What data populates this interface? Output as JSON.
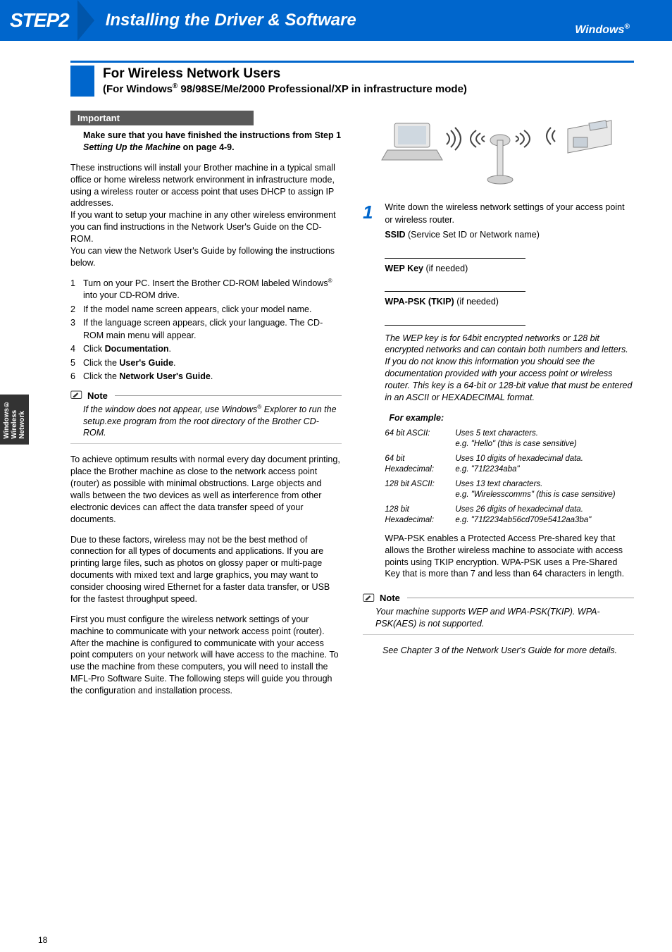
{
  "banner": {
    "step": "STEP2",
    "title": "Installing the Driver & Software",
    "platform": "Windows",
    "reg": "®"
  },
  "section": {
    "title": "For Wireless Network Users",
    "subtitle_pre": "(For Windows",
    "subtitle_post": " 98/98SE/Me/2000 Professional/XP in infrastructure mode)"
  },
  "important": {
    "heading": "Important",
    "text_pre": "Make sure that you have finished the instructions from Step 1 ",
    "text_em": "Setting Up the Machine",
    "text_post": " on page 4-9."
  },
  "intro": "These instructions will install your Brother machine in a typical small office or home wireless network environment in infrastructure mode, using a wireless router or access point that uses DHCP to assign IP addresses.\nIf you want to setup your machine in any other wireless environment you can find instructions in the Network User's Guide on the CD-ROM.\nYou can view the Network User's Guide by following the instructions below.",
  "list": [
    {
      "n": "1",
      "pre": "Turn on your PC. Insert the Brother CD-ROM labeled Windows",
      "sup": "®",
      "post": " into your CD-ROM drive."
    },
    {
      "n": "2",
      "text": "If the model name screen appears, click your model name."
    },
    {
      "n": "3",
      "text": "If the language screen appears, click your language. The CD-ROM main menu will appear."
    },
    {
      "n": "4",
      "pre": "Click ",
      "b": "Documentation",
      "post": "."
    },
    {
      "n": "5",
      "pre": "Click the ",
      "b": "User's Guide",
      "post": "."
    },
    {
      "n": "6",
      "pre": "Click the ",
      "b": "Network User's Guide",
      "post": "."
    }
  ],
  "note1": {
    "label": "Note",
    "body_pre": "If the window does not appear, use Windows",
    "body_sup": "®",
    "body_post": " Explorer to run the setup.exe program from the root directory of the Brother CD-ROM."
  },
  "para2": "To achieve optimum results with normal every day document printing, place the Brother machine as close to the network access point (router) as possible with minimal obstructions. Large objects and walls between the two devices as well as interference from other electronic devices can affect the data transfer speed of your documents.",
  "para3": "Due to these factors, wireless may not be the best method of connection for all types of documents and applications. If you are printing large files, such as photos on glossy paper or multi-page documents with mixed text and large graphics, you may want to consider choosing wired Ethernet for a faster data transfer, or USB for the fastest throughput speed.",
  "para4": "First you must configure the wireless network settings of your machine to communicate with your network access point (router). After the machine is configured to communicate with your access point computers on your network will have access to the machine. To use the machine from these computers, you will need to install the MFL-Pro Software Suite. The following steps will guide you through the configuration and installation process.",
  "step1": {
    "num": "1",
    "intro": "Write down the wireless network settings of your access point or wireless router.",
    "ssid_pre": "SSID",
    "ssid_post": " (Service Set ID or Network name)",
    "wep_pre": "WEP Key",
    "wep_post": " (if needed)",
    "wpa_pre": "WPA-PSK (TKIP)",
    "wpa_post": "  (if needed)",
    "wep_info": "The WEP key is for 64bit encrypted networks or 128 bit encrypted networks and can contain both numbers and letters. If you do not know this information you should see the documentation provided with your access point or wireless router. This key is a 64-bit or 128-bit value that must be entered in an ASCII or HEXADECIMAL format.",
    "example_head": "For example:",
    "examples": [
      {
        "label": "64 bit ASCII:",
        "val": "Uses 5 text characters.\ne.g. \"Hello\" (this is case sensitive)"
      },
      {
        "label": "64 bit Hexadecimal:",
        "val": "Uses 10 digits of hexadecimal data.\ne.g. \"71f2234aba\""
      },
      {
        "label": "128 bit ASCII:",
        "val": "Uses 13 text characters.\ne.g. \"Wirelesscomms\" (this is case sensitive)"
      },
      {
        "label": "128 bit Hexadecimal:",
        "val": "Uses 26 digits of hexadecimal data.\ne.g. \"71f2234ab56cd709e5412aa3ba\""
      }
    ],
    "wpa_info": "WPA-PSK enables a Protected Access Pre-shared key that allows the Brother wireless machine to associate with access points using TKIP encryption. WPA-PSK uses a Pre-Shared Key that is more than 7 and less than 64 characters in length."
  },
  "note2": {
    "label": "Note",
    "body": "Your machine supports WEP and WPA-PSK(TKIP). WPA-PSK(AES) is not supported."
  },
  "see_more": "See Chapter 3 of the Network User's Guide for more details.",
  "side_tab": "Windows®\nWireless\nNetwork",
  "page_num": "18"
}
